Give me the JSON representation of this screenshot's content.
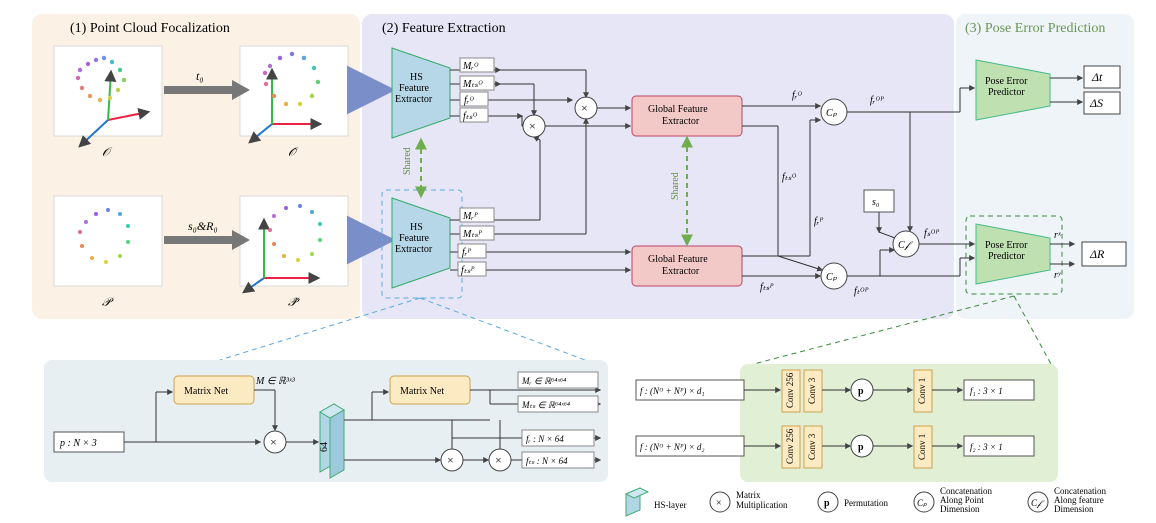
{
  "panels": {
    "p1_title": "(1) Point Cloud Focalization",
    "p2_title": "(2) Feature Extraction",
    "p3_title": "(3) Pose Error Prediction"
  },
  "arrows": {
    "t0": "t₀",
    "s0R0": "s₀&R₀"
  },
  "clouds": {
    "O": "𝒪",
    "Ohat": "𝒪̂",
    "P": "𝒫",
    "Phat": "𝒫̂"
  },
  "hs": {
    "label": "HS\nFeature\nExtractor",
    "shared": "Shared"
  },
  "hs_out": {
    "MrO": "Mᵣᴼ",
    "MtsO": "Mₜₛᴼ",
    "frO": "fᵣᴼ",
    "ftsO": "fₜₛᴼ",
    "MrP": "Mᵣᴾ",
    "MtsP": "Mₜₛᴾ",
    "frP": "fᵣᴾ",
    "ftsP": "fₜₛᴾ"
  },
  "gfe": {
    "label": "Global Feature\nExtractor",
    "shared": "Shared"
  },
  "gfe_out": {
    "frO": "fᵣᴼ",
    "ftsO": "fₜₛᴼ",
    "frP": "fᵣᴾ",
    "ftsP": "fₜₛᴾ"
  },
  "concat": {
    "Cp": "Cₚ",
    "Cf": "C𝒻"
  },
  "s0": "s₀",
  "mix": {
    "frOP": "fᵣᴼᴾ",
    "fsOP": "fₛᴼᴾ",
    "ftOP": "fₜᴼᴾ"
  },
  "pep": {
    "label": "Pose Error\nPredictor",
    "dt": "Δt",
    "dS": "ΔS",
    "rx": "rˣ",
    "ry": "rʸ",
    "dR": "ΔR"
  },
  "sub_hs": {
    "mn": "Matrix Net",
    "p": "p : N × 3",
    "M": "M ∈ ℝ³ˣ³",
    "sixtyfour": "64",
    "Mr": "Mᵣ ∈ ℝ⁶⁴ˣ⁶⁴",
    "Mts": "Mₜₛ ∈ ℝ⁶⁴ˣ⁶⁴",
    "fr": "fᵣ : N × 64",
    "fts": "fₜₛ : N × 64"
  },
  "sub_pep": {
    "fin1": "f : (Nᴼ + Nᴾ) × d₁",
    "fin2": "f : (Nᴼ + Nᴾ) × d₂",
    "c256": "Conv 256",
    "c3": "Conv 3",
    "c1": "Conv 1",
    "f1": "f₁ : 3 × 1",
    "f2": "f₂ : 3 × 1",
    "perm": "p"
  },
  "legend": {
    "hs": "HS-layer",
    "mm": "Matrix\nMultiplication",
    "perm": "Permutation",
    "cp": "Concatenation\nAlong Point\nDimension",
    "cf": "Concatenation\nAlong feature\nDimension"
  }
}
